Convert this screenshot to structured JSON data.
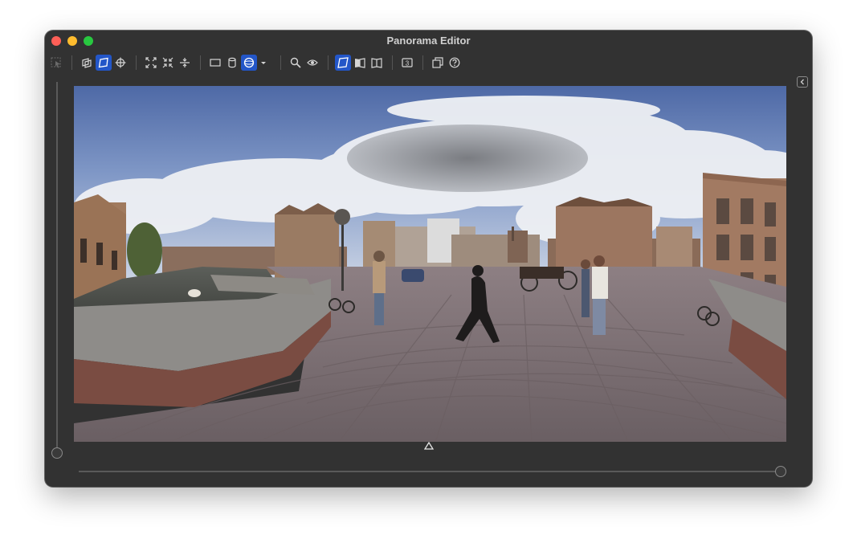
{
  "window": {
    "title": "Panorama Editor"
  },
  "toolbar": {
    "groups": [
      [
        {
          "name": "select-tool-icon",
          "active": false,
          "disabled": true
        }
      ],
      [
        {
          "name": "plane-layers-icon",
          "active": false
        },
        {
          "name": "perspective-plane-icon",
          "active": true
        },
        {
          "name": "crosshair-icon",
          "active": false
        }
      ],
      [
        {
          "name": "expand-arrows-icon",
          "active": false
        },
        {
          "name": "contract-arrows-icon",
          "active": false
        },
        {
          "name": "vertical-compress-icon",
          "active": false
        }
      ],
      [
        {
          "name": "rectangle-shape-icon",
          "active": false
        },
        {
          "name": "cylinder-shape-icon",
          "active": false
        },
        {
          "name": "sphere-shape-icon",
          "active": true
        },
        {
          "name": "chevron-down-icon",
          "active": false
        }
      ],
      [
        {
          "name": "zoom-icon",
          "active": false
        },
        {
          "name": "eye-icon",
          "active": false
        }
      ],
      [
        {
          "name": "flat-view-icon",
          "active": true
        },
        {
          "name": "half-view-icon",
          "active": false
        },
        {
          "name": "book-view-icon",
          "active": false
        }
      ],
      [
        {
          "name": "three-d-badge-icon",
          "active": false,
          "label": "3"
        }
      ],
      [
        {
          "name": "copy-layers-icon",
          "active": false
        },
        {
          "name": "help-icon",
          "active": false
        }
      ]
    ]
  },
  "viewer": {
    "image_description_icon": "equirectangular-panorama-image",
    "horizon_marker_icon": "triangle-up-icon",
    "collapse_icon": "chevron-left-icon"
  },
  "sliders": {
    "vertical": {
      "value": 0.0
    },
    "horizontal": {
      "value": 1.0
    }
  },
  "colors": {
    "accent": "#2356c8",
    "window_bg": "#323232"
  }
}
